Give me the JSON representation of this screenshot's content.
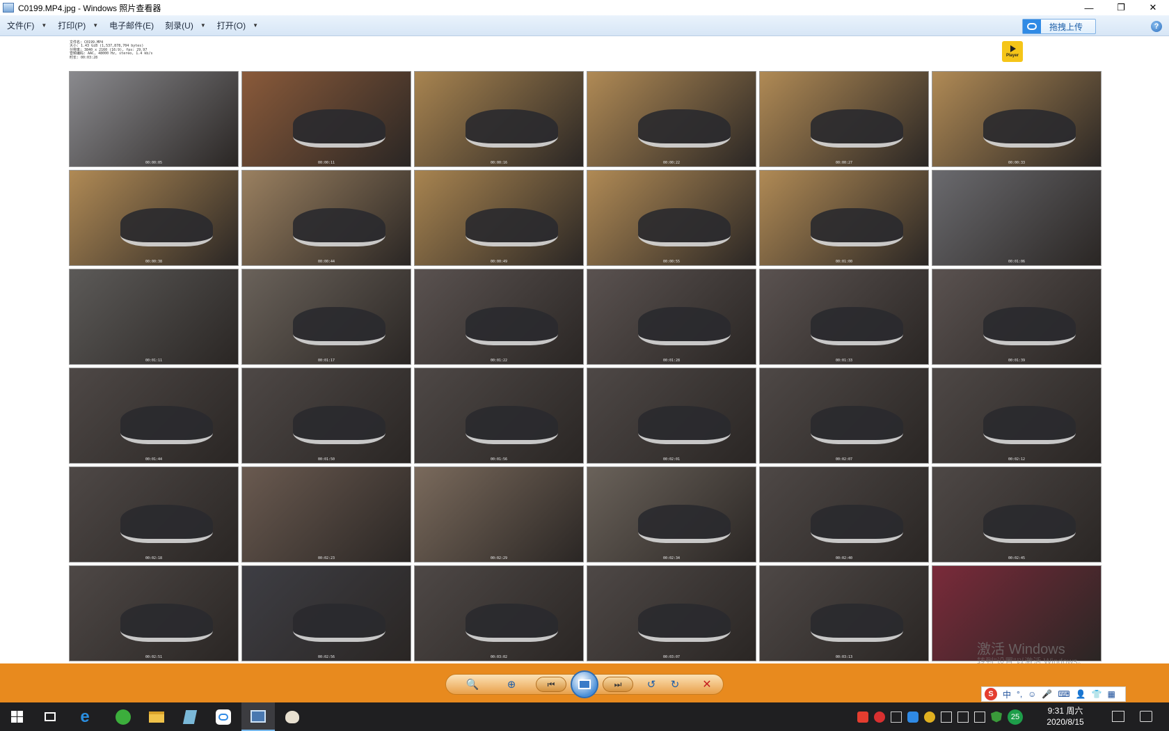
{
  "window": {
    "title": "C0199.MP4.jpg - Windows 照片查看器",
    "minimize": "—",
    "restore": "❐",
    "close": "✕"
  },
  "menu": {
    "items": [
      {
        "label": "文件(F)"
      },
      {
        "label": "打印(P)"
      },
      {
        "label": "电子邮件(E)"
      },
      {
        "label": "刻录(U)"
      },
      {
        "label": "打开(O)"
      }
    ],
    "upload_label": "拖拽上传",
    "help": "?"
  },
  "sheet": {
    "meta_lines": [
      "文件名: C0199.MP4",
      "大小: 1.43 GiB (1,537,878,704 bytes)",
      "分辨率: 3840 x 2160 (16:9), fps: 29.97",
      "音频编码: AAC, 48000 Hz, stereo, 1.4 kb/s",
      "时长: 00:03:28"
    ],
    "player_badge": "Player"
  },
  "thumbnails": [
    {
      "ts": "00:00:05",
      "bg": "#8a8a8e"
    },
    {
      "ts": "00:00:11",
      "bg": "#8a5a3a"
    },
    {
      "ts": "00:00:16",
      "bg": "#a88450"
    },
    {
      "ts": "00:00:22",
      "bg": "#b08a55"
    },
    {
      "ts": "00:00:27",
      "bg": "#b08a55"
    },
    {
      "ts": "00:00:33",
      "bg": "#b08a55"
    },
    {
      "ts": "00:00:38",
      "bg": "#b08a55"
    },
    {
      "ts": "00:00:44",
      "bg": "#9a8060"
    },
    {
      "ts": "00:00:49",
      "bg": "#a88450"
    },
    {
      "ts": "00:00:55",
      "bg": "#b08a55"
    },
    {
      "ts": "00:01:00",
      "bg": "#b08a55"
    },
    {
      "ts": "00:01:06",
      "bg": "#6a6a6e"
    },
    {
      "ts": "00:01:11",
      "bg": "#5c5a58"
    },
    {
      "ts": "00:01:17",
      "bg": "#6a625a"
    },
    {
      "ts": "00:01:22",
      "bg": "#5a5250"
    },
    {
      "ts": "00:01:28",
      "bg": "#5a5250"
    },
    {
      "ts": "00:01:33",
      "bg": "#5a5250"
    },
    {
      "ts": "00:01:39",
      "bg": "#5a5250"
    },
    {
      "ts": "00:01:44",
      "bg": "#4e4846"
    },
    {
      "ts": "00:01:50",
      "bg": "#4e4846"
    },
    {
      "ts": "00:01:56",
      "bg": "#4e4846"
    },
    {
      "ts": "00:02:01",
      "bg": "#4e4846"
    },
    {
      "ts": "00:02:07",
      "bg": "#4e4846"
    },
    {
      "ts": "00:02:12",
      "bg": "#4e4846"
    },
    {
      "ts": "00:02:18",
      "bg": "#4e4846"
    },
    {
      "ts": "00:02:23",
      "bg": "#6a5a50"
    },
    {
      "ts": "00:02:29",
      "bg": "#7a6a5c"
    },
    {
      "ts": "00:02:34",
      "bg": "#6a625a"
    },
    {
      "ts": "00:02:40",
      "bg": "#4e4846"
    },
    {
      "ts": "00:02:45",
      "bg": "#4e4846"
    },
    {
      "ts": "00:02:51",
      "bg": "#4e4846"
    },
    {
      "ts": "00:02:56",
      "bg": "#3e3e44"
    },
    {
      "ts": "00:03:02",
      "bg": "#4e4846"
    },
    {
      "ts": "00:03:07",
      "bg": "#4e4846"
    },
    {
      "ts": "00:03:13",
      "bg": "#4e4846"
    },
    {
      "ts": "",
      "bg": "#7a2a3a"
    }
  ],
  "watermark": {
    "line1": "激活 Windows",
    "line2": "转到\"设置\"以激活 Windows。"
  },
  "controls": {
    "zoom": "🔍",
    "fit": "⊕",
    "prev": "⏮",
    "next": "⏭",
    "rotate_ccw": "↺",
    "rotate_cw": "↻",
    "delete": "✕"
  },
  "ime": {
    "logo": "S",
    "lang": "中",
    "punct": "°,",
    "emoji": "☺",
    "mic": "🎤",
    "kbd": "⌨",
    "user": "👤",
    "shirt": "👕",
    "grid": "▦"
  },
  "taskbar": {
    "time": "9:31 周六",
    "date": "2020/8/15",
    "badge": "25"
  }
}
